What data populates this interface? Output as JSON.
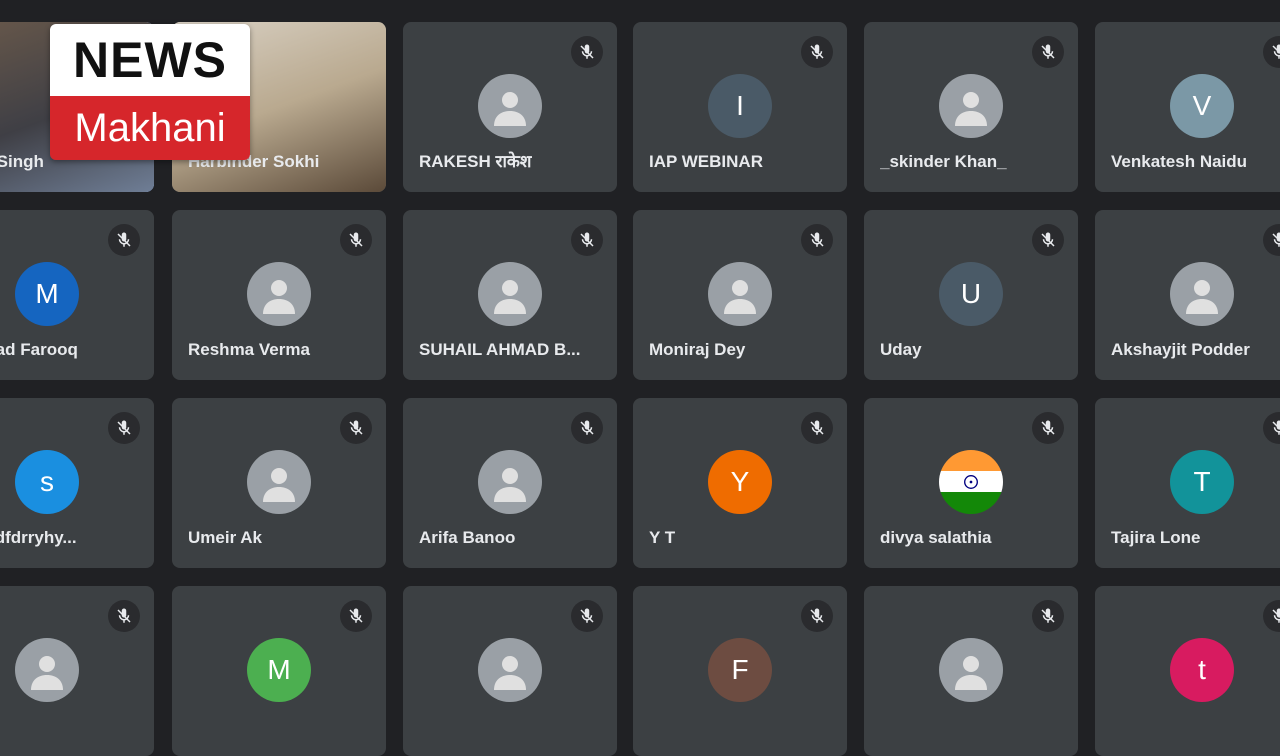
{
  "logo": {
    "line1": "NEWS",
    "line2": "Makhani"
  },
  "colors": {
    "tile_bg": "#3c4043",
    "page_bg": "#202124",
    "active_border": "#8ab4f8"
  },
  "participants": [
    {
      "name": "rjeet Singh",
      "type": "video",
      "mic": "none",
      "active": true
    },
    {
      "name": "Harbinder Sokhi",
      "type": "video",
      "mic": "none"
    },
    {
      "name": "RAKESH राकेश",
      "type": "photo",
      "mic": "muted"
    },
    {
      "name": "IAP WEBINAR",
      "type": "initial",
      "initial": "I",
      "color": "#4a5a67",
      "mic": "muted"
    },
    {
      "name": "_skinder Khan_",
      "type": "photo",
      "mic": "muted"
    },
    {
      "name": "Venkatesh Naidu",
      "type": "initial",
      "initial": "V",
      "color": "#7b98a6",
      "mic": "muted"
    },
    {
      "name": "ammad Farooq",
      "type": "initial",
      "initial": "M",
      "color": "#1565c0",
      "mic": "muted"
    },
    {
      "name": "Reshma Verma",
      "type": "photo",
      "mic": "muted"
    },
    {
      "name": "SUHAIL AHMAD B...",
      "type": "photo",
      "mic": "muted"
    },
    {
      "name": "Moniraj Dey",
      "type": "photo",
      "mic": "muted"
    },
    {
      "name": "Uday",
      "type": "initial",
      "initial": "U",
      "color": "#4a5a67",
      "mic": "muted"
    },
    {
      "name": "Akshayjit Podder",
      "type": "photo",
      "mic": "muted"
    },
    {
      "name": "a gs dfdrryhy...",
      "type": "initial",
      "initial": "s",
      "color": "#1a8fe0",
      "mic": "muted"
    },
    {
      "name": "Umeir Ak",
      "type": "photo",
      "mic": "muted"
    },
    {
      "name": "Arifa Banoo",
      "type": "photo",
      "mic": "muted"
    },
    {
      "name": "Y T",
      "type": "initial",
      "initial": "Y",
      "color": "#ef6c00",
      "mic": "muted"
    },
    {
      "name": "divya salathia",
      "type": "flag",
      "mic": "muted"
    },
    {
      "name": "Tajira Lone",
      "type": "initial",
      "initial": "T",
      "color": "#12939a",
      "mic": "muted"
    },
    {
      "name": "",
      "type": "photo",
      "mic": "muted"
    },
    {
      "name": "",
      "type": "initial",
      "initial": "M",
      "color": "#4caf50",
      "mic": "muted"
    },
    {
      "name": "",
      "type": "photo",
      "mic": "muted"
    },
    {
      "name": "",
      "type": "initial",
      "initial": "F",
      "color": "#6d4c41",
      "mic": "muted"
    },
    {
      "name": "",
      "type": "photo",
      "mic": "muted"
    },
    {
      "name": "",
      "type": "initial",
      "initial": "t",
      "color": "#d81b60",
      "mic": "muted"
    }
  ]
}
